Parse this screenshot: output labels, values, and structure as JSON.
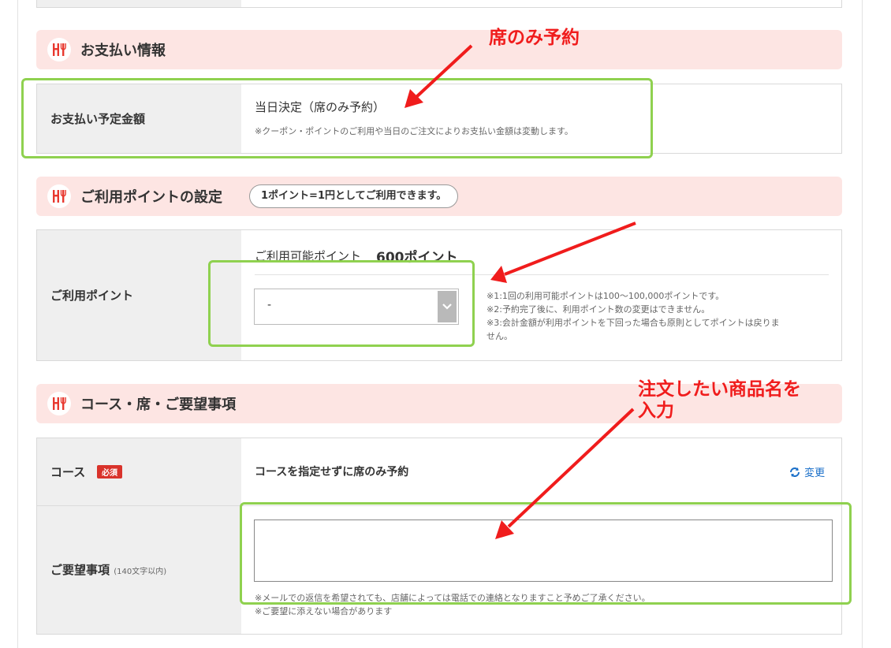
{
  "payment_section": {
    "title": "お支払い情報",
    "row_label": "お支払い予定金額",
    "value": "当日決定（席のみ予約）",
    "note": "※クーポン・ポイントのご利用や当日のご注文によりお支払い金額は変動します。"
  },
  "points_section": {
    "title": "ご利用ポイントの設定",
    "pill": "1ポイント=1円としてご利用できます。",
    "row_label": "ご利用ポイント",
    "available_label": "ご利用可能ポイント",
    "available_value": "600ポイント",
    "select_value": "-",
    "notes": [
      "※1:1回の利用可能ポイントは100〜100,000ポイントです。",
      "※2:予約完了後に、利用ポイント数の変更はできません。",
      "※3:会計金額が利用ポイントを下回った場合も原則としてポイントは戻りま",
      "せん。"
    ]
  },
  "course_section": {
    "title": "コース・席・ご要望事項",
    "course_label": "コース",
    "required_badge": "必須",
    "course_value": "コースを指定せずに席のみ予約",
    "change_link": "変更",
    "request_label": "ご要望事項",
    "request_limit": "(140文字以内)",
    "request_value": "",
    "request_notes": [
      "※メールでの返信を希望されても、店舗によっては電話での連絡となりますこと予めご了承ください。",
      "※ご要望に添えない場合があります"
    ]
  },
  "annotations": {
    "seat_only": "席のみ予約",
    "enter_item_line1": "注文したい商品名を",
    "enter_item_line2": "入力"
  },
  "colors": {
    "header_bg": "#fde5e3",
    "icon_red": "#e8382f",
    "annotation_red": "#f01c1c",
    "highlight_green": "#8fd14f",
    "link_blue": "#1a6fc9",
    "label_bg": "#efefef"
  },
  "icons": {
    "section": "restaurant-fork-knife-icon",
    "select": "chevron-down-icon",
    "change": "refresh-icon"
  }
}
